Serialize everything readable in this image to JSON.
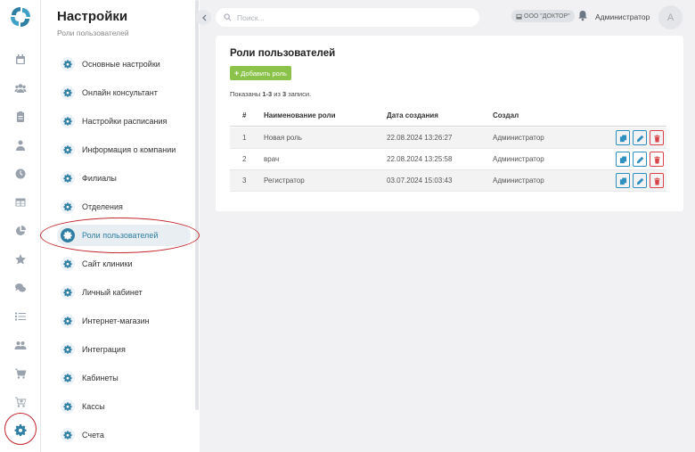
{
  "rail": {
    "icons": [
      "calendar-icon",
      "users-icon",
      "clipboard-icon",
      "doctor-icon",
      "clock-icon",
      "table-icon",
      "pie-chart-icon",
      "star-icon",
      "chat-icon",
      "list-icon",
      "group-icon",
      "cart-icon",
      "cart-plus-icon",
      "gear-icon"
    ],
    "active": "gear-icon"
  },
  "menu": {
    "title": "Настройки",
    "subtitle": "Роли пользователей",
    "items": [
      {
        "label": "Основные настройки"
      },
      {
        "label": "Онлайн консультант"
      },
      {
        "label": "Настройки расписания"
      },
      {
        "label": "Информация о компании"
      },
      {
        "label": "Филиалы"
      },
      {
        "label": "Отделения"
      },
      {
        "label": "Роли пользователей",
        "active": true
      },
      {
        "label": "Сайт клиники"
      },
      {
        "label": "Личный кабинет"
      },
      {
        "label": "Интернет-магазин"
      },
      {
        "label": "Интеграция"
      },
      {
        "label": "Кабинеты"
      },
      {
        "label": "Кассы"
      },
      {
        "label": "Счета"
      }
    ]
  },
  "header": {
    "search_placeholder": "Поиск...",
    "org": "ООО \"ДОКТОР\"",
    "user": "Администратор",
    "avatar_letter": "A"
  },
  "card": {
    "title": "Роли пользователей",
    "add_label": "Добавить роль",
    "records_prefix": "Показаны ",
    "records_range": "1-3",
    "records_mid": " из ",
    "records_total": "3",
    "records_suffix": " записи.",
    "columns": {
      "num": "#",
      "name": "Наименование роли",
      "date": "Дата создания",
      "by": "Создал"
    },
    "rows": [
      {
        "num": "1",
        "name": "Новая роль",
        "date": "22.08.2024 13:26:27",
        "by": "Администратор"
      },
      {
        "num": "2",
        "name": "врач",
        "date": "22.08.2024 13:25:58",
        "by": "Администратор"
      },
      {
        "num": "3",
        "name": "Регистратор",
        "date": "03.07.2024 15:03:43",
        "by": "Администратор"
      }
    ]
  },
  "colors": {
    "accent": "#2f7fa3",
    "add_button": "#8bc34a",
    "delete": "#d9434a",
    "highlight_ring": "#c0262d"
  }
}
